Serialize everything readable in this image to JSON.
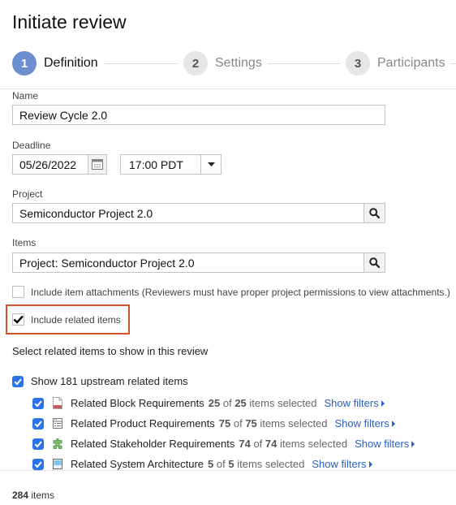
{
  "page": {
    "title": "Initiate review"
  },
  "steps": [
    {
      "number": "1",
      "label": "Definition",
      "state": "active"
    },
    {
      "number": "2",
      "label": "Settings",
      "state": "inactive"
    },
    {
      "number": "3",
      "label": "Participants",
      "state": "inactive"
    }
  ],
  "form": {
    "name": {
      "label": "Name",
      "value": "Review Cycle 2.0"
    },
    "deadline": {
      "label": "Deadline",
      "date": "05/26/2022",
      "time": "17:00 PDT",
      "calendar_icon": "calendar-icon",
      "dropdown_icon": "caret-down-icon"
    },
    "project": {
      "label": "Project",
      "value": "Semiconductor Project 2.0",
      "search_icon": "search-icon"
    },
    "items": {
      "label": "Items",
      "value": "Project: Semiconductor Project 2.0",
      "search_icon": "search-icon"
    },
    "include_attachments": {
      "label": "Include item attachments (Reviewers must have proper project permissions to view attachments.)",
      "checked": false
    },
    "include_related": {
      "label": "Include related items",
      "checked": true,
      "highlight_color": "#d4512e"
    }
  },
  "related": {
    "heading": "Select related items to show in this review",
    "upstream": {
      "label": "Show 181 upstream related items",
      "checked": true
    },
    "rows": [
      {
        "icon": "document-icon",
        "label": "Related Block Requirements",
        "selected": "25",
        "total": "25",
        "of": "of",
        "suffix": "items selected",
        "filters": "Show filters",
        "checked": true
      },
      {
        "icon": "list-window-icon",
        "label": "Related Product Requirements",
        "selected": "75",
        "total": "75",
        "of": "of",
        "suffix": "items selected",
        "filters": "Show filters",
        "checked": true
      },
      {
        "icon": "puzzle-icon",
        "label": "Related Stakeholder Requirements",
        "selected": "74",
        "total": "74",
        "of": "of",
        "suffix": "items selected",
        "filters": "Show filters",
        "checked": true
      },
      {
        "icon": "architecture-icon",
        "label": "Related System Architecture",
        "selected": "5",
        "total": "5",
        "of": "of",
        "suffix": "items selected",
        "filters": "Show filters",
        "checked": true
      }
    ]
  },
  "footer": {
    "count": "284",
    "label": "items"
  },
  "colors": {
    "accent": "#2a73e8",
    "step_active": "#6d8fd0",
    "link": "#2a5fc4"
  }
}
